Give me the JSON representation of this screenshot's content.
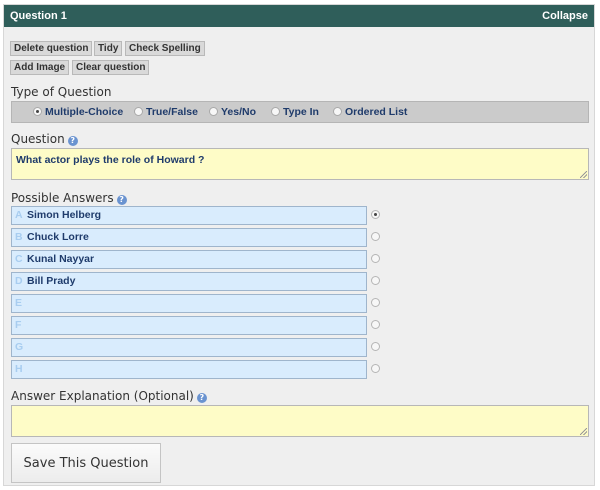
{
  "header": {
    "title": "Question 1",
    "collapse": "Collapse",
    "bg": "#2f5e5a"
  },
  "toolbar": {
    "delete": "Delete question",
    "tidy": "Tidy",
    "spell": "Check Spelling",
    "add_image": "Add Image",
    "clear": "Clear question"
  },
  "type_section": {
    "label": "Type of Question",
    "options": [
      "Multiple-Choice",
      "True/False",
      "Yes/No",
      "Type In",
      "Ordered List"
    ],
    "selected": "Multiple-Choice"
  },
  "question": {
    "label": "Question",
    "value": "What actor plays the role of Howard ?"
  },
  "answers": {
    "label": "Possible Answers",
    "items": [
      {
        "letter": "A",
        "text": "Simon Helberg"
      },
      {
        "letter": "B",
        "text": "Chuck Lorre"
      },
      {
        "letter": "C",
        "text": "Kunal Nayyar"
      },
      {
        "letter": "D",
        "text": "Bill Prady"
      },
      {
        "letter": "E",
        "text": ""
      },
      {
        "letter": "F",
        "text": ""
      },
      {
        "letter": "G",
        "text": ""
      },
      {
        "letter": "H",
        "text": ""
      }
    ],
    "correct": "A"
  },
  "explanation": {
    "label": "Answer Explanation (Optional)",
    "value": ""
  },
  "save_label": "Save This Question",
  "colors": {
    "answer_bg": "#d9ecfd",
    "textarea_bg": "#fefcc7",
    "type_bar": "#cbcbcb"
  }
}
